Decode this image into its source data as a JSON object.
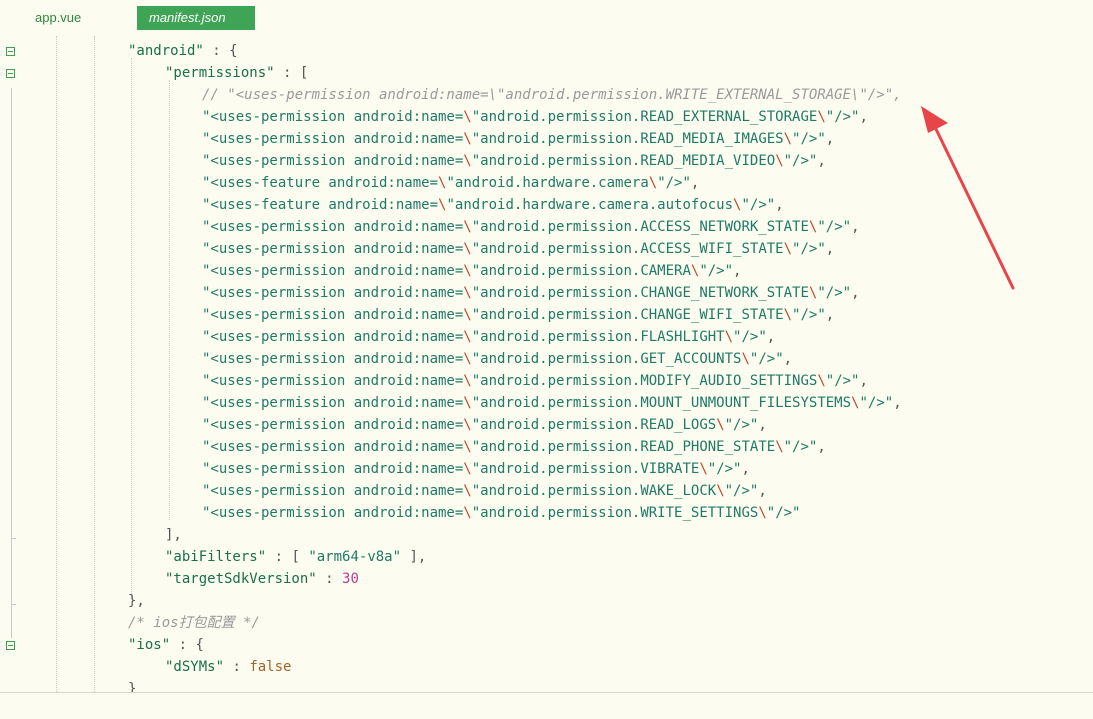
{
  "tabs": [
    {
      "label": "app.vue",
      "active": false
    },
    {
      "label": "manifest.json",
      "active": true
    }
  ],
  "code": {
    "android_key": "\"android\"",
    "permissions_key": "\"permissions\"",
    "commented_prefix": "// \"<uses-permission android:name=\\\"android.permission.WRITE_EXTERNAL_STORAGE\\\"/>\",",
    "lines": [
      {
        "pre": "\"<uses-permission android:name=",
        "value": "android.permission.READ_EXTERNAL_STORAGE",
        "comma": ","
      },
      {
        "pre": "\"<uses-permission android:name=",
        "value": "android.permission.READ_MEDIA_IMAGES",
        "comma": ","
      },
      {
        "pre": "\"<uses-permission android:name=",
        "value": "android.permission.READ_MEDIA_VIDEO",
        "comma": ","
      },
      {
        "pre": "\"<uses-feature android:name=",
        "value": "android.hardware.camera",
        "comma": ","
      },
      {
        "pre": "\"<uses-feature android:name=",
        "value": "android.hardware.camera.autofocus",
        "comma": ","
      },
      {
        "pre": "\"<uses-permission android:name=",
        "value": "android.permission.ACCESS_NETWORK_STATE",
        "comma": ","
      },
      {
        "pre": "\"<uses-permission android:name=",
        "value": "android.permission.ACCESS_WIFI_STATE",
        "comma": ","
      },
      {
        "pre": "\"<uses-permission android:name=",
        "value": "android.permission.CAMERA",
        "comma": ","
      },
      {
        "pre": "\"<uses-permission android:name=",
        "value": "android.permission.CHANGE_NETWORK_STATE",
        "comma": ","
      },
      {
        "pre": "\"<uses-permission android:name=",
        "value": "android.permission.CHANGE_WIFI_STATE",
        "comma": ","
      },
      {
        "pre": "\"<uses-permission android:name=",
        "value": "android.permission.FLASHLIGHT",
        "comma": ","
      },
      {
        "pre": "\"<uses-permission android:name=",
        "value": "android.permission.GET_ACCOUNTS",
        "comma": ","
      },
      {
        "pre": "\"<uses-permission android:name=",
        "value": "android.permission.MODIFY_AUDIO_SETTINGS",
        "comma": ","
      },
      {
        "pre": "\"<uses-permission android:name=",
        "value": "android.permission.MOUNT_UNMOUNT_FILESYSTEMS",
        "comma": ","
      },
      {
        "pre": "\"<uses-permission android:name=",
        "value": "android.permission.READ_LOGS",
        "comma": ","
      },
      {
        "pre": "\"<uses-permission android:name=",
        "value": "android.permission.READ_PHONE_STATE",
        "comma": ","
      },
      {
        "pre": "\"<uses-permission android:name=",
        "value": "android.permission.VIBRATE",
        "comma": ","
      },
      {
        "pre": "\"<uses-permission android:name=",
        "value": "android.permission.WAKE_LOCK",
        "comma": ","
      },
      {
        "pre": "\"<uses-permission android:name=",
        "value": "android.permission.WRITE_SETTINGS",
        "comma": ""
      }
    ],
    "abi_key": "\"abiFilters\"",
    "abi_value": "\"arm64-v8a\"",
    "target_key": "\"targetSdkVersion\"",
    "target_value": "30",
    "ios_comment": "/* ios打包配置 */",
    "ios_key": "\"ios\"",
    "dsyms_key": "\"dSYMs\"",
    "dsyms_value": "false"
  },
  "colors": {
    "accent_tab": "#3fa456",
    "annotation_arrow": "#e8454a",
    "editor_bg": "#fdfcf1"
  },
  "icons": {
    "fold": "fold-collapse-icon",
    "annotation": "red-arrow-annotation"
  }
}
